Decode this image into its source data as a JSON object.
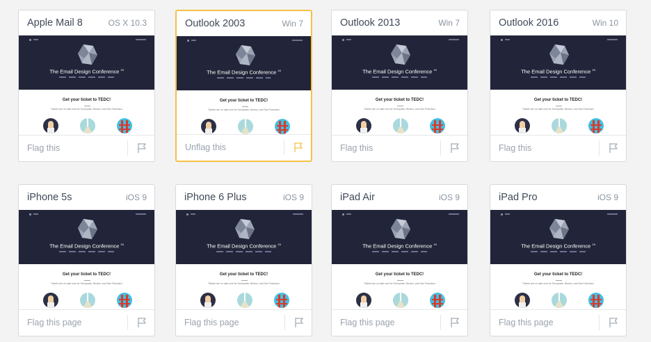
{
  "cards": [
    {
      "client": "Apple Mail 8",
      "platform": "OS X 10.3",
      "flag_label": "Flag this",
      "flagged": false
    },
    {
      "client": "Outlook 2003",
      "platform": "Win 7",
      "flag_label": "Unflag this",
      "flagged": true
    },
    {
      "client": "Outlook 2013",
      "platform": "Win 7",
      "flag_label": "Flag this",
      "flagged": false
    },
    {
      "client": "Outlook 2016",
      "platform": "Win 10",
      "flag_label": "Flag this",
      "flagged": false
    },
    {
      "client": "iPhone 5s",
      "platform": "iOS 9",
      "flag_label": "Flag this page",
      "flagged": false
    },
    {
      "client": "iPhone 6 Plus",
      "platform": "iOS 9",
      "flag_label": "Flag this page",
      "flagged": false
    },
    {
      "client": "iPad Air",
      "platform": "iOS 9",
      "flag_label": "Flag this page",
      "flagged": false
    },
    {
      "client": "iPad Pro",
      "platform": "iOS 9",
      "flag_label": "Flag this page",
      "flagged": false
    }
  ],
  "preview": {
    "conference_title": "The Email Design Conference",
    "conference_title_sup": "16",
    "ticket_heading": "Get your ticket to TEDC!",
    "ticket_subtext": "Tickets are on sale now for Sunnyvale, Boston, and San Francisco"
  },
  "colors": {
    "hero_bg": "#222539",
    "flag_active": "#f5c046",
    "flag_inactive": "#a4adb6"
  },
  "icons": {
    "flag": "flag-icon",
    "gem": "gem-logo-icon"
  }
}
